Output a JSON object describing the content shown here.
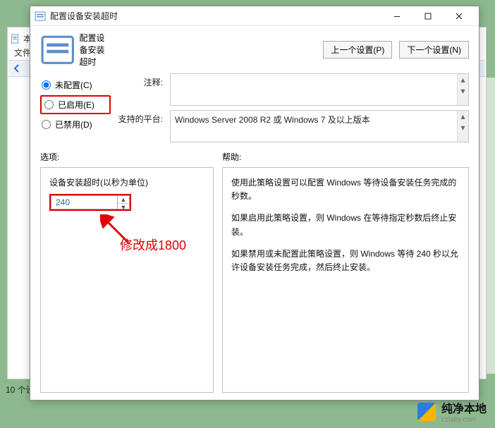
{
  "bgwin": {
    "title_prefix": "本",
    "menu_file": "文件",
    "footer_count": "10 个设"
  },
  "dialog": {
    "title": "配置设备安装超时",
    "subtitle": "配置设备安装超时",
    "prev_btn": "上一个设置(P)",
    "next_btn": "下一个设置(N)",
    "radios": {
      "not_configured": "未配置(C)",
      "enabled": "已启用(E)",
      "disabled": "已禁用(D)"
    },
    "meta": {
      "comment_label": "注释:",
      "comment_value": "",
      "platform_label": "支持的平台:",
      "platform_value": "Windows Server 2008 R2 或 Windows 7 及以上版本"
    },
    "sections": {
      "options_label": "选项:",
      "help_label": "帮助:"
    },
    "option_field": {
      "label": "设备安装超时(以秒为单位)",
      "value": "240"
    },
    "annotation": "修改成1800",
    "help": {
      "p1": "使用此策略设置可以配置 Windows 等待设备安装任务完成的秒数。",
      "p2": "如果启用此策略设置，则 Windows 在等待指定秒数后终止安装。",
      "p3": "如果禁用或未配置此策略设置，则 Windows 等待 240 秒以允许设备安装任务完成，然后终止安装。"
    }
  },
  "watermark": {
    "cn": "纯净本地",
    "en": "czlaby.com"
  }
}
